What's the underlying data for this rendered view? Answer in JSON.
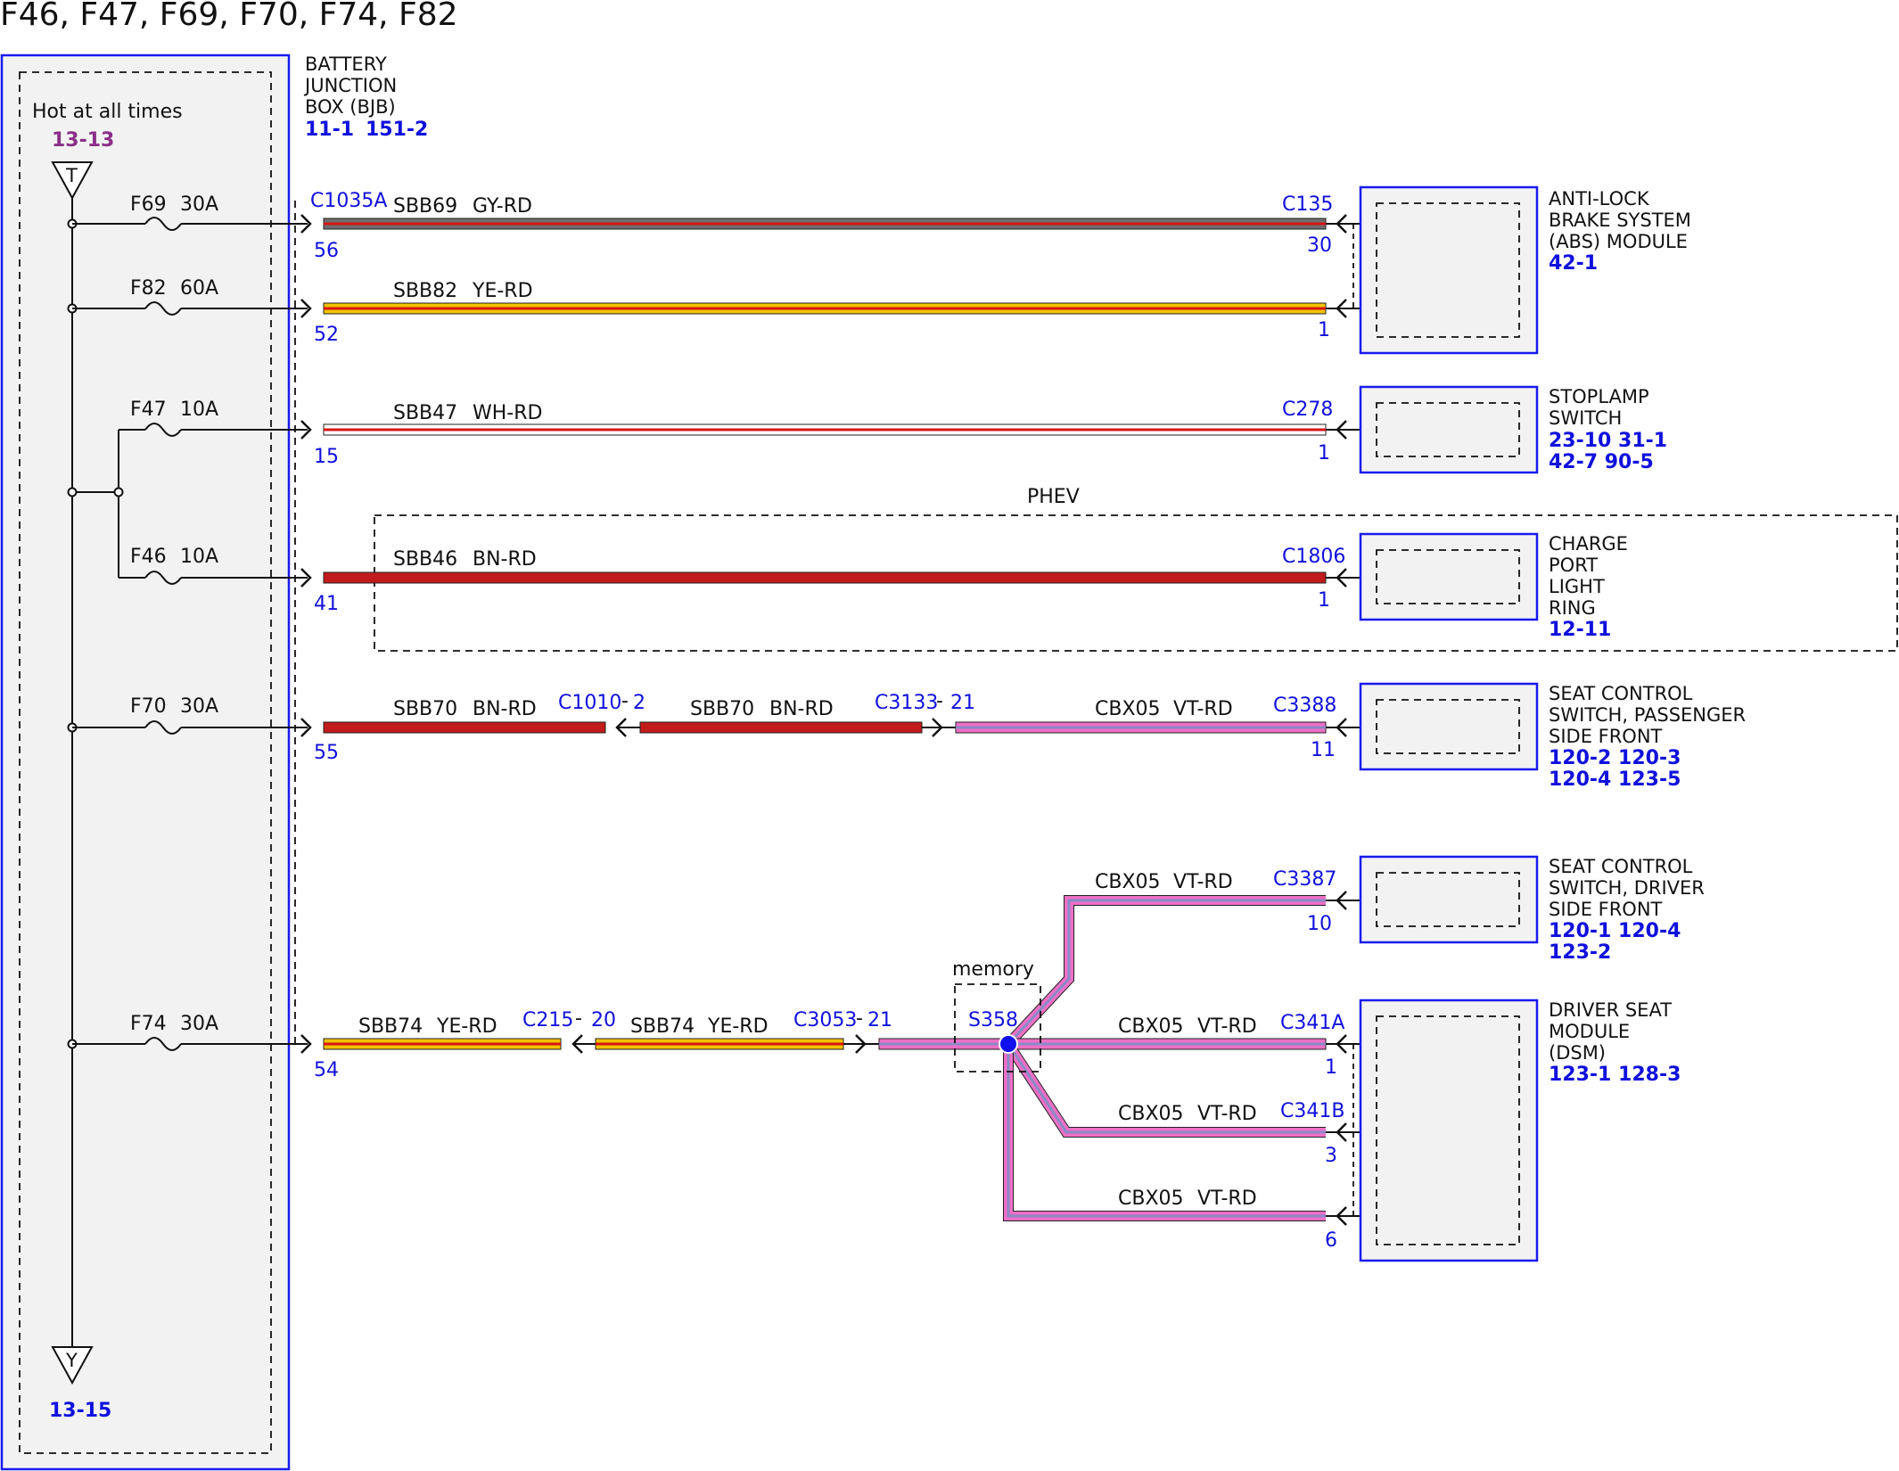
{
  "title": "F46, F47, F69, F70, F74, F82",
  "bjb": {
    "name_lines": [
      "BATTERY",
      "JUNCTION",
      "BOX (BJB)"
    ],
    "refs": [
      "11-1",
      "151-2"
    ],
    "hot_label": "Hot at all times",
    "top_ref": "13-13",
    "top_symbol": "T",
    "bottom_ref": "13-15",
    "bottom_symbol": "Y"
  },
  "circuits": [
    {
      "fuse": "F69",
      "amp": "30A",
      "conn": "C1035A",
      "pin": "56",
      "wire": "SBB69",
      "color": "GY-RD",
      "far_conn": "C135",
      "far_pin": "30"
    },
    {
      "fuse": "F82",
      "amp": "60A",
      "pin": "52",
      "wire": "SBB82",
      "color": "YE-RD",
      "far_pin": "1"
    },
    {
      "fuse": "F47",
      "amp": "10A",
      "pin": "15",
      "wire": "SBB47",
      "color": "WH-RD",
      "far_conn": "C278",
      "far_pin": "1"
    },
    {
      "fuse": "F46",
      "amp": "10A",
      "pin": "41",
      "wire": "SBB46",
      "color": "BN-RD",
      "far_conn": "C1806",
      "far_pin": "1"
    },
    {
      "fuse": "F70",
      "amp": "30A",
      "pin": "55",
      "wire": "SBB70",
      "color": "BN-RD",
      "inline1_conn": "C1010",
      "inline1_pin": "2",
      "wire2": "SBB70",
      "color2": "BN-RD",
      "inline2_conn": "C3133",
      "inline2_pin": "21",
      "wire3": "CBX05",
      "color3": "VT-RD",
      "far_conn": "C3388",
      "far_pin": "11"
    },
    {
      "fuse": "F74",
      "amp": "30A",
      "pin": "54",
      "wire": "SBB74",
      "color": "YE-RD",
      "inline1_conn": "C215",
      "inline1_pin": "20",
      "wire2": "SBB74",
      "color2": "YE-RD",
      "inline2_conn": "C3053",
      "inline2_pin": "21"
    }
  ],
  "phev_label": "PHEV",
  "splice": {
    "label": "memory",
    "id": "S358"
  },
  "dsm_branches": [
    {
      "wire": "CBX05",
      "color": "VT-RD",
      "conn": "C3387",
      "pin": "10"
    },
    {
      "wire": "CBX05",
      "color": "VT-RD",
      "conn": "C341A",
      "pin": "1"
    },
    {
      "wire": "CBX05",
      "color": "VT-RD",
      "conn": "C341B",
      "pin": "3"
    },
    {
      "wire": "CBX05",
      "color": "VT-RD",
      "pin": "6"
    }
  ],
  "components": [
    {
      "lines": [
        "ANTI-LOCK",
        "BRAKE SYSTEM",
        "(ABS) MODULE"
      ],
      "refs": [
        "42-1"
      ]
    },
    {
      "lines": [
        "STOPLAMP",
        "SWITCH"
      ],
      "refs": [
        "23-10 31-1",
        "42-7   90-5"
      ]
    },
    {
      "lines": [
        "CHARGE",
        "PORT",
        "LIGHT",
        "RING"
      ],
      "refs": [
        "12-11"
      ]
    },
    {
      "lines": [
        "SEAT CONTROL",
        "SWITCH, PASSENGER",
        "SIDE FRONT"
      ],
      "refs": [
        "120-2 120-3",
        "120-4 123-5"
      ]
    },
    {
      "lines": [
        "SEAT CONTROL",
        "SWITCH, DRIVER",
        "SIDE FRONT"
      ],
      "refs": [
        "120-1 120-4",
        "123-2"
      ]
    },
    {
      "lines": [
        "DRIVER SEAT",
        "MODULE",
        "(DSM)"
      ],
      "refs": [
        "123-1 128-3"
      ]
    }
  ],
  "wire_colors": {
    "GY-RD": "#6e6e6e",
    "YE-RD": "#f2c300",
    "WH-RD": "#ffffff",
    "BN-RD": "#c21b1b",
    "VT-RD": "#ee6fc6",
    "stripe": "#d81414",
    "link": "#1010dd",
    "box_border": "#1a1aee"
  }
}
